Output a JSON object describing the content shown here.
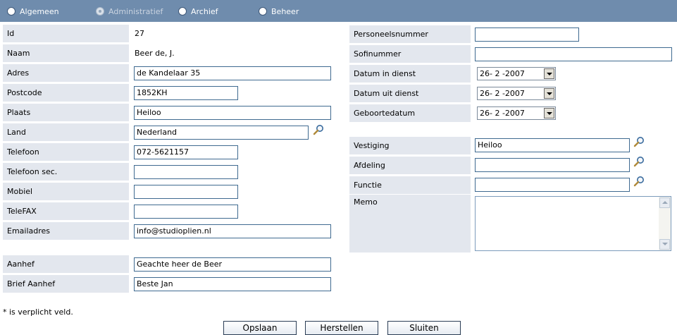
{
  "tabs": [
    {
      "label": "Algemeen",
      "state": "enabled"
    },
    {
      "label": "Administratief",
      "state": "active"
    },
    {
      "label": "Archief",
      "state": "enabled"
    },
    {
      "label": "Beheer",
      "state": "enabled"
    }
  ],
  "left": {
    "id": {
      "label": "Id",
      "value": "27"
    },
    "naam": {
      "label": "Naam",
      "value": "Beer de, J."
    },
    "adres": {
      "label": "Adres",
      "value": "de Kandelaar 35"
    },
    "postcode": {
      "label": "Postcode",
      "value": "1852KH"
    },
    "plaats": {
      "label": "Plaats",
      "value": "Heiloo"
    },
    "land": {
      "label": "Land",
      "value": "Nederland"
    },
    "telefoon": {
      "label": "Telefoon",
      "value": "072-5621157"
    },
    "telefoon_sec": {
      "label": "Telefoon sec.",
      "value": ""
    },
    "mobiel": {
      "label": "Mobiel",
      "value": ""
    },
    "telefax": {
      "label": "TeleFAX",
      "value": ""
    },
    "emailadres": {
      "label": "Emailadres",
      "value": "info@studioplien.nl"
    },
    "aanhef": {
      "label": "Aanhef",
      "value": "Geachte heer de Beer"
    },
    "brief_aanhef": {
      "label": "Brief Aanhef",
      "value": "Beste Jan"
    }
  },
  "right": {
    "personeelsnummer": {
      "label": "Personeelsnummer",
      "value": ""
    },
    "sofinummer": {
      "label": "Sofinummer",
      "value": ""
    },
    "datum_in_dienst": {
      "label": "Datum in dienst",
      "value": "26- 2 -2007"
    },
    "datum_uit_dienst": {
      "label": "Datum uit dienst",
      "value": "26- 2 -2007"
    },
    "geboortedatum": {
      "label": "Geboortedatum",
      "value": "26- 2 -2007"
    },
    "vestiging": {
      "label": "Vestiging",
      "value": "Heiloo"
    },
    "afdeling": {
      "label": "Afdeling",
      "value": ""
    },
    "functie": {
      "label": "Functie",
      "value": ""
    },
    "memo": {
      "label": "Memo",
      "value": ""
    }
  },
  "footer": {
    "required_note": "* is verplicht veld.",
    "save_label": "Opslaan",
    "reset_label": "Herstellen",
    "close_label": "Sluiten"
  },
  "colors": {
    "tabbar": "#6f8cad",
    "label_bg": "#e3e7ee",
    "input_border": "#3f6a90"
  },
  "icons": {
    "lookup": "magnifier-icon",
    "dropdown": "chevron-down-icon"
  }
}
